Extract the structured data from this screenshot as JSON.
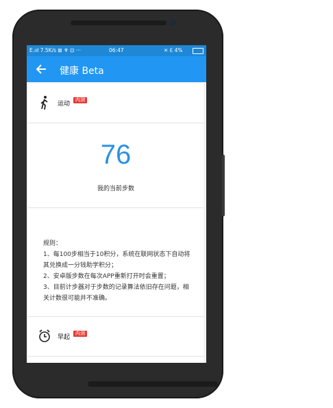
{
  "status_bar": {
    "left": "E.ııl  7.5K/s  ⊠  ♆  ⊡  ···",
    "time": "06:47",
    "right": "✕  ℇ  4%"
  },
  "app_bar": {
    "title": "健康 Beta",
    "back_icon": "arrow-left-icon"
  },
  "sections": {
    "exercise": {
      "label": "运动",
      "badge": "内测",
      "icon": "walking-person-icon"
    },
    "steps": {
      "value": "76",
      "label": "我的当前步数"
    },
    "rules": {
      "text": "规则：\n1、每100步相当于10积分，系统在联网状态下自动将其兑换成一分钱助学积分；\n2、安卓版步数在每次APP重新打开时会重置；\n3、目前计步器对于步数的记录算法依旧存在问题，相关计数很可能并不准确。"
    },
    "early_rise": {
      "label": "早起",
      "badge": "内测",
      "icon": "alarm-clock-icon"
    }
  }
}
